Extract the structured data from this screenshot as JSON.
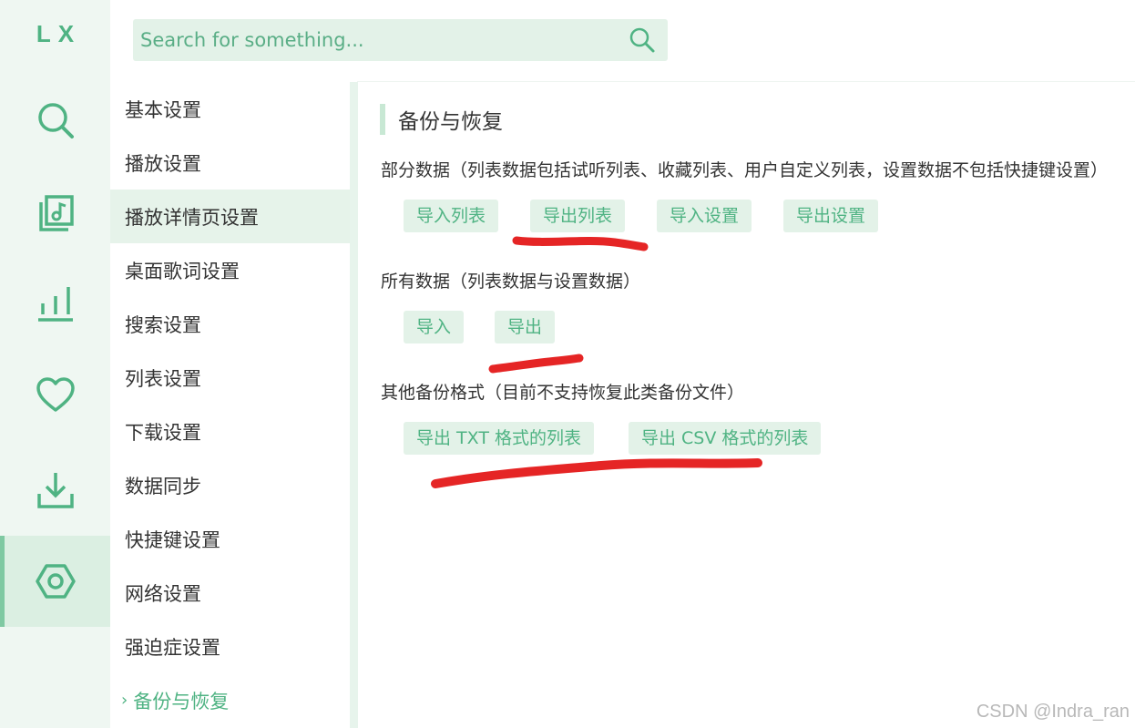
{
  "app": {
    "logo": "LX"
  },
  "colors": {
    "accent": "#4fb383",
    "rail_bg": "#eff7f2",
    "button_bg": "#e3f2e8",
    "annotation": "#e52525"
  },
  "rail": [
    {
      "icon": "search-icon"
    },
    {
      "icon": "music-list-icon"
    },
    {
      "icon": "chart-bars-icon"
    },
    {
      "icon": "heart-icon"
    },
    {
      "icon": "download-icon"
    },
    {
      "icon": "settings-hexagon-icon",
      "active": true
    }
  ],
  "search": {
    "placeholder": "Search for something..."
  },
  "nav": {
    "items": [
      {
        "label": "基本设置"
      },
      {
        "label": "播放设置"
      },
      {
        "label": "播放详情页设置"
      },
      {
        "label": "桌面歌词设置"
      },
      {
        "label": "搜索设置"
      },
      {
        "label": "列表设置"
      },
      {
        "label": "下载设置"
      },
      {
        "label": "数据同步"
      },
      {
        "label": "快捷键设置"
      },
      {
        "label": "网络设置"
      },
      {
        "label": "强迫症设置"
      },
      {
        "label": "备份与恢复",
        "current": true
      }
    ]
  },
  "main": {
    "title": "备份与恢复",
    "partial": {
      "desc": "部分数据（列表数据包括试听列表、收藏列表、用户自定义列表，设置数据不包括快捷键设置）",
      "buttons": [
        "导入列表",
        "导出列表",
        "导入设置",
        "导出设置"
      ]
    },
    "all": {
      "desc": "所有数据（列表数据与设置数据）",
      "buttons": [
        "导入",
        "导出"
      ]
    },
    "other": {
      "desc": "其他备份格式（目前不支持恢复此类备份文件）",
      "buttons": [
        "导出 TXT 格式的列表",
        "导出 CSV 格式的列表"
      ]
    }
  },
  "watermark": "CSDN @Indra_ran"
}
